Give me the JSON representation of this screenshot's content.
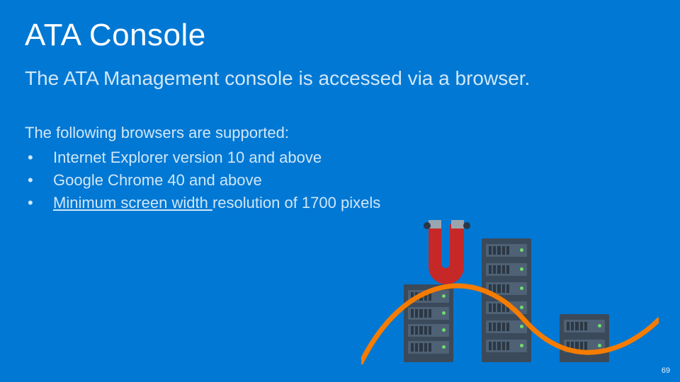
{
  "title": "ATA Console",
  "subtitle": "The ATA Management console is accessed via a browser.",
  "intro": "The following browsers are supported:",
  "bullets": [
    {
      "text": "Internet Explorer version 10 and above"
    },
    {
      "text": "Google Chrome 40 and above"
    },
    {
      "text_pre": "Minimum screen width ",
      "text_post": "resolution of 1700 pixels"
    }
  ],
  "page_number": "69",
  "colors": {
    "background": "#0078d4",
    "magnet": "#c62828",
    "cable": "#f57c00"
  }
}
